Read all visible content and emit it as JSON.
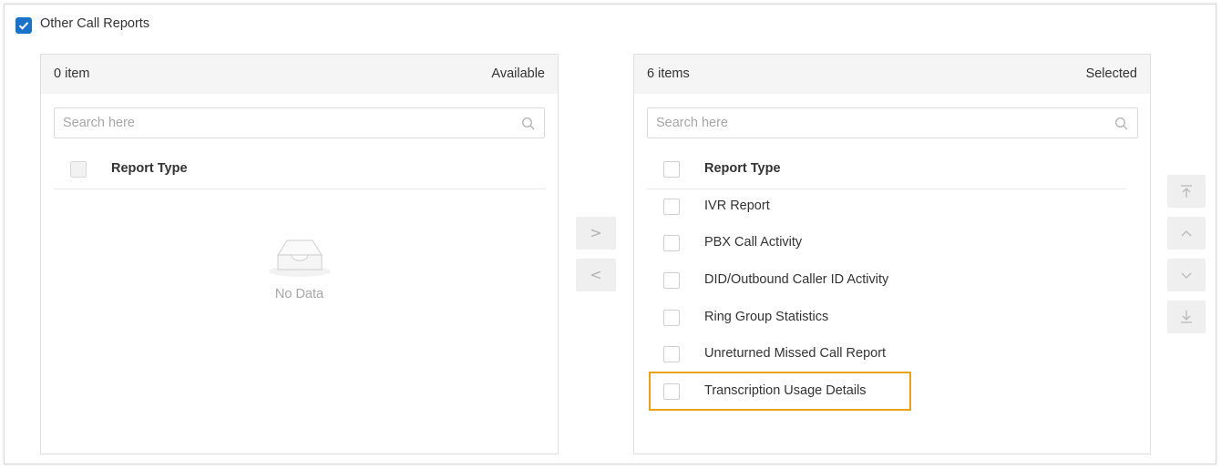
{
  "section": {
    "title": "Other Call Reports",
    "checked": true,
    "accent_color": "#1a73c8"
  },
  "left_panel": {
    "count": "0 item",
    "title": "Available",
    "search_placeholder": "Search here",
    "column_header": "Report Type",
    "empty_text": "No Data",
    "empty_icon": "empty-tray-icon"
  },
  "transfer": {
    "move_right_label": ">",
    "move_left_label": "<"
  },
  "right_panel": {
    "count": "6 items",
    "title": "Selected",
    "search_placeholder": "Search here",
    "column_header": "Report Type",
    "items": [
      {
        "label": "IVR Report"
      },
      {
        "label": "PBX Call Activity"
      },
      {
        "label": "DID/Outbound Caller ID Activity"
      },
      {
        "label": "Ring Group Statistics"
      },
      {
        "label": "Unreturned Missed Call Report"
      },
      {
        "label": "Transcription Usage Details"
      }
    ],
    "highlight_color": "#e8a317"
  },
  "sort_buttons": [
    {
      "icon": "move-to-top-icon"
    },
    {
      "icon": "move-up-icon"
    },
    {
      "icon": "move-down-icon"
    },
    {
      "icon": "move-to-bottom-icon"
    }
  ]
}
